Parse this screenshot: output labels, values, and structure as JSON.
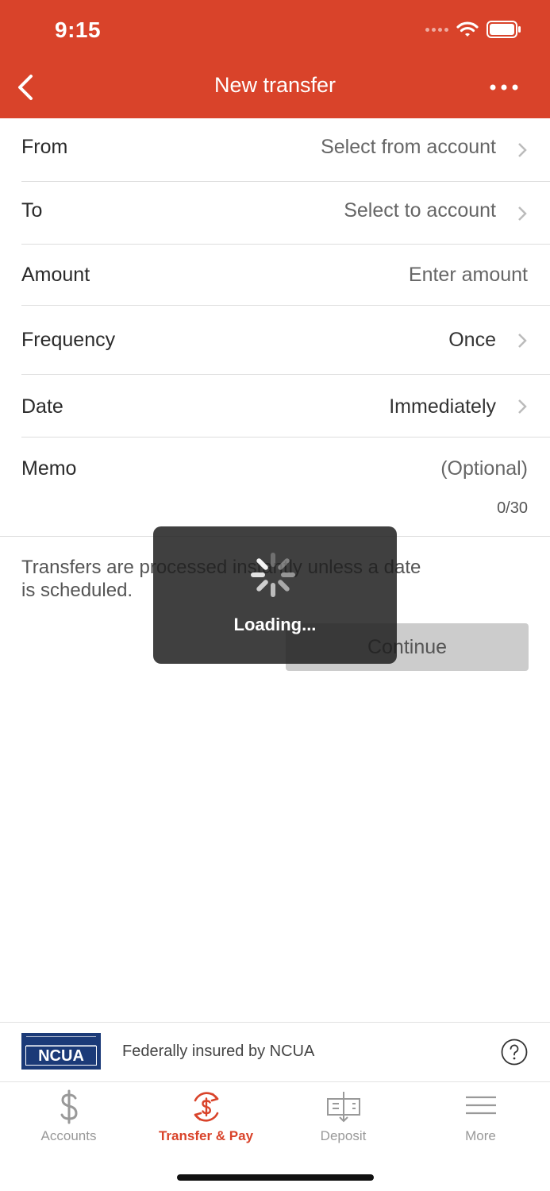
{
  "status": {
    "time": "9:15"
  },
  "nav": {
    "title": "New transfer"
  },
  "form": {
    "from": {
      "label": "From",
      "value": "Select from account"
    },
    "to": {
      "label": "To",
      "value": "Select to account"
    },
    "amount": {
      "label": "Amount",
      "placeholder": "Enter amount"
    },
    "frequency": {
      "label": "Frequency",
      "value": "Once"
    },
    "date": {
      "label": "Date",
      "value": "Immediately"
    },
    "memo": {
      "label": "Memo",
      "placeholder": "(Optional)",
      "counter": "0/30"
    }
  },
  "info": {
    "line1": "Transfers are processed instantly unless a date",
    "line2": "is scheduled."
  },
  "continue_label": "Continue",
  "loading": {
    "text": "Loading..."
  },
  "footer": {
    "ncua_logo": "NCUA",
    "insured_text": "Federally insured by NCUA"
  },
  "tabs": [
    {
      "label": "Accounts",
      "icon": "dollar-icon"
    },
    {
      "label": "Transfer & Pay",
      "icon": "transfer-pay-icon",
      "active": true
    },
    {
      "label": "Deposit",
      "icon": "deposit-check-icon"
    },
    {
      "label": "More",
      "icon": "hamburger-menu-icon"
    }
  ],
  "colors": {
    "brand": "#d9432a",
    "button_disabled": "#cccccc"
  }
}
